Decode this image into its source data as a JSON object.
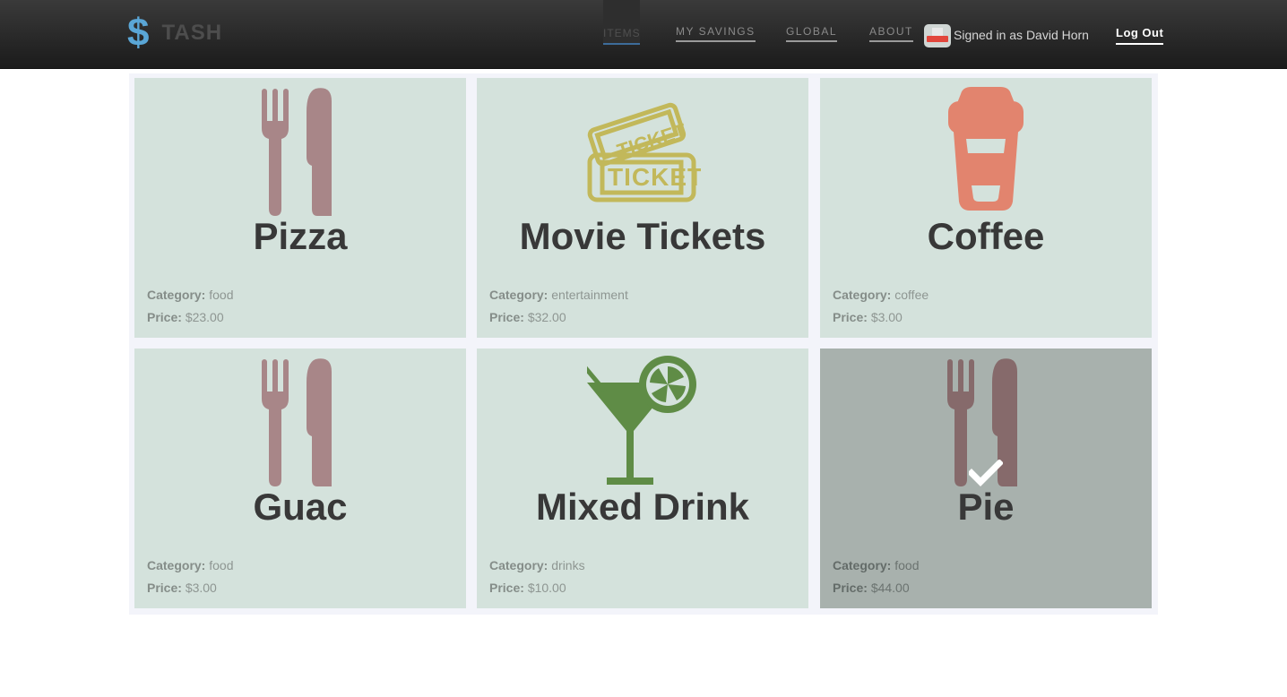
{
  "brand": {
    "symbol": "$",
    "name": "TASH"
  },
  "nav": {
    "items_label": "ITEMS",
    "savings_label": "MY SAVINGS",
    "global_label": "GLOBAL",
    "about_label": "ABOUT",
    "signed_in_text": "Signed in as David Horn",
    "logout_label": "Log Out"
  },
  "labels": {
    "category": "Category:",
    "price": "Price:"
  },
  "colors": {
    "card_bg": "#d4e2dc",
    "card_selected_bg": "#a8b1ad",
    "accent_blue": "#5aa6d6"
  },
  "items": [
    {
      "name": "Pizza",
      "category": "food",
      "price": "$23.00",
      "icon": "fork-knife-icon"
    },
    {
      "name": "Movie Tickets",
      "category": "entertainment",
      "price": "$32.00",
      "icon": "ticket-icon"
    },
    {
      "name": "Coffee",
      "category": "coffee",
      "price": "$3.00",
      "icon": "coffee-cup-icon"
    },
    {
      "name": "Guac",
      "category": "food",
      "price": "$3.00",
      "icon": "fork-knife-icon"
    },
    {
      "name": "Mixed Drink",
      "category": "drinks",
      "price": "$10.00",
      "icon": "cocktail-icon"
    },
    {
      "name": "Pie",
      "category": "food",
      "price": "$44.00",
      "icon": "fork-knife-icon",
      "selected": true
    }
  ]
}
